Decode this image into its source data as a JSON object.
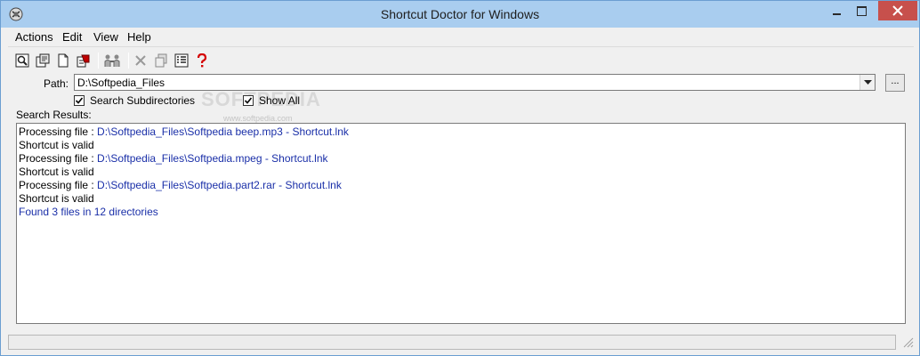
{
  "window": {
    "title": "Shortcut Doctor for Windows"
  },
  "menu": [
    "Actions",
    "Edit",
    "View",
    "Help"
  ],
  "toolbar": {
    "icons": [
      "search-icon",
      "properties-icon",
      "new-document-icon",
      "fix-icon",
      "group-icon",
      "delete-icon",
      "copy-icon",
      "list-icon",
      "help-icon"
    ]
  },
  "path": {
    "label": "Path:",
    "value": "D:\\Softpedia_Files",
    "browse_label": "..."
  },
  "options": {
    "search_subdirectories": {
      "label": "Search Subdirectories",
      "checked": true
    },
    "show_all": {
      "label": "Show All",
      "checked": true
    }
  },
  "watermark": {
    "text": "SOFTPEDIA",
    "sub": "www.softpedia.com"
  },
  "results": {
    "label": "Search Results:",
    "lines": [
      {
        "prefix": "Processing file : ",
        "path": "D:\\Softpedia_Files\\Softpedia beep.mp3 - Shortcut.lnk"
      },
      {
        "text": "Shortcut is valid"
      },
      {
        "prefix": "Processing file : ",
        "path": "D:\\Softpedia_Files\\Softpedia.mpeg - Shortcut.lnk"
      },
      {
        "text": "Shortcut is valid"
      },
      {
        "prefix": "Processing file : ",
        "path": "D:\\Softpedia_Files\\Softpedia.part2.rar - Shortcut.lnk"
      },
      {
        "text": "Shortcut is valid"
      },
      {
        "summary": "Found 3 files in 12 directories"
      }
    ]
  },
  "colors": {
    "titlebar": "#a9cdef",
    "close_button": "#c7504c",
    "link_blue": "#1a2fa8"
  }
}
